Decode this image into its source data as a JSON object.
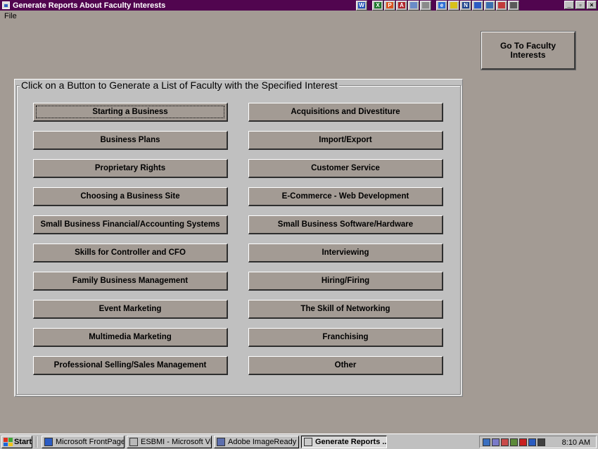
{
  "window": {
    "title": "Generate Reports About Faculty Interests",
    "controls": {
      "minimize": "_",
      "restore": "▫",
      "close": "×"
    }
  },
  "quicklaunch": [
    {
      "icon": "word-icon",
      "glyph": "W",
      "color": "#1f4fb8"
    },
    {
      "icon": "excel-icon",
      "glyph": "X",
      "color": "#1e7a2e"
    },
    {
      "icon": "powerpoint-icon",
      "glyph": "P",
      "color": "#d9531e"
    },
    {
      "icon": "access-icon",
      "glyph": "A",
      "color": "#b0232a"
    },
    {
      "icon": "find-icon",
      "glyph": "",
      "color": "#6a8cc8"
    },
    {
      "icon": "office-icon",
      "glyph": "",
      "color": "#8a8a8a"
    },
    {
      "icon": "internet-explorer-icon",
      "glyph": "e",
      "color": "#2d6fd6"
    },
    {
      "icon": "norton-icon",
      "glyph": "",
      "color": "#d8c21a"
    },
    {
      "icon": "n-icon",
      "glyph": "N",
      "color": "#1b3f8c"
    },
    {
      "icon": "network-icon",
      "glyph": "",
      "color": "#2b5cc4"
    },
    {
      "icon": "document-icon",
      "glyph": "",
      "color": "#3b6fb0"
    },
    {
      "icon": "tools-icon",
      "glyph": "",
      "color": "#c23b3b"
    },
    {
      "icon": "pointer-icon",
      "glyph": "",
      "color": "#5a5a5a"
    }
  ],
  "menubar": {
    "file": "File"
  },
  "goto_button": {
    "label": "Go To Faculty\nInterests"
  },
  "group": {
    "label": "Click on a Button to Generate a List of Faculty with the Specified Interest",
    "left_buttons": [
      "Starting a Business",
      "Business Plans",
      "Proprietary Rights",
      "Choosing a Business Site",
      "Small Business Financial/Accounting Systems",
      "Skills for Controller and CFO",
      "Family Business Management",
      "Event Marketing",
      "Multimedia Marketing",
      "Professional Selling/Sales Management"
    ],
    "right_buttons": [
      "Acquisitions and Divestiture",
      "Import/Export",
      "Customer Service",
      "E-Commerce - Web Development",
      "Small Business Software/Hardware",
      "Interviewing",
      "Hiring/Firing",
      "The Skill of Networking",
      "Franchising",
      "Other"
    ],
    "focused": "Starting a Business"
  },
  "taskbar": {
    "start": "Start",
    "tasks": [
      {
        "label": "Microsoft FrontPage - C...",
        "icon": "frontpage-icon",
        "active": false
      },
      {
        "label": "ESBMI - Microsoft Visu...",
        "icon": "visual-basic-icon",
        "active": false
      },
      {
        "label": "Adobe ImageReady",
        "icon": "imageready-icon",
        "active": false
      },
      {
        "label": "Generate Reports ...",
        "icon": "form-icon",
        "active": true
      }
    ],
    "tray_icons": [
      "monitor-icon",
      "network-tray-icon",
      "pen-icon",
      "plug-icon",
      "antivirus-icon",
      "messenger-icon",
      "display-icon"
    ],
    "clock": "8:10 AM"
  },
  "colors": {
    "background": "#a39b94",
    "titlebar": "#51054f",
    "panel": "#c0c0c0"
  }
}
